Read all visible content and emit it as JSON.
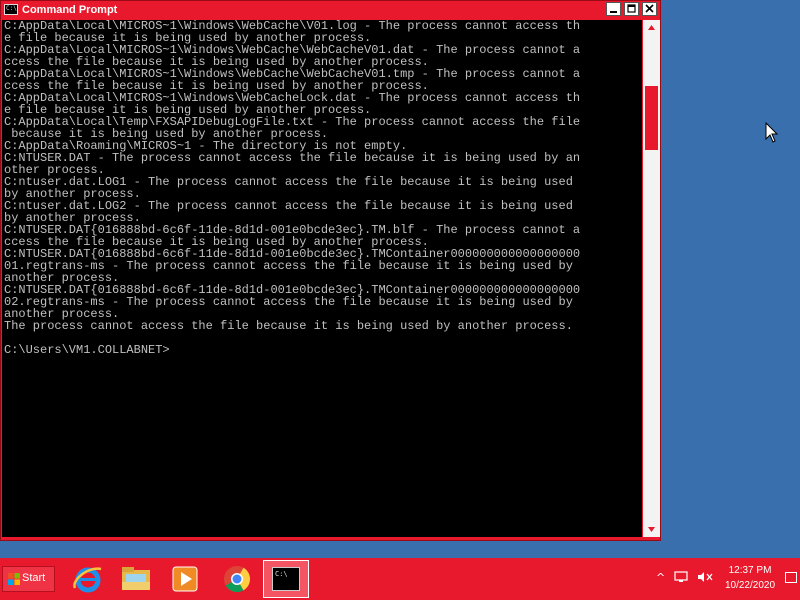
{
  "window": {
    "title": "Command Prompt",
    "icon_text": "C:\\",
    "minimize_icon": "minimize-icon",
    "maximize_icon": "maximize-icon",
    "close_icon": "close-icon"
  },
  "console": {
    "lines": [
      "C:AppData\\Local\\MICROS~1\\Windows\\WebCache\\V01.log - The process cannot access th",
      "e file because it is being used by another process.",
      "C:AppData\\Local\\MICROS~1\\Windows\\WebCache\\WebCacheV01.dat - The process cannot a",
      "ccess the file because it is being used by another process.",
      "C:AppData\\Local\\MICROS~1\\Windows\\WebCache\\WebCacheV01.tmp - The process cannot a",
      "ccess the file because it is being used by another process.",
      "C:AppData\\Local\\MICROS~1\\Windows\\WebCacheLock.dat - The process cannot access th",
      "e file because it is being used by another process.",
      "C:AppData\\Local\\Temp\\FXSAPIDebugLogFile.txt - The process cannot access the file",
      " because it is being used by another process.",
      "C:AppData\\Roaming\\MICROS~1 - The directory is not empty.",
      "C:NTUSER.DAT - The process cannot access the file because it is being used by an",
      "other process.",
      "C:ntuser.dat.LOG1 - The process cannot access the file because it is being used",
      "by another process.",
      "C:ntuser.dat.LOG2 - The process cannot access the file because it is being used",
      "by another process.",
      "C:NTUSER.DAT{016888bd-6c6f-11de-8d1d-001e0bcde3ec}.TM.blf - The process cannot a",
      "ccess the file because it is being used by another process.",
      "C:NTUSER.DAT{016888bd-6c6f-11de-8d1d-001e0bcde3ec}.TMContainer000000000000000000",
      "01.regtrans-ms - The process cannot access the file because it is being used by",
      "another process.",
      "C:NTUSER.DAT{016888bd-6c6f-11de-8d1d-001e0bcde3ec}.TMContainer000000000000000000",
      "02.regtrans-ms - The process cannot access the file because it is being used by",
      "another process.",
      "The process cannot access the file because it is being used by another process.",
      "",
      "C:\\Users\\VM1.COLLABNET>"
    ]
  },
  "taskbar": {
    "start_label": "Start",
    "cmd_task_text": "C:\\",
    "apps": [
      "internet-explorer-icon",
      "file-explorer-icon",
      "media-player-icon",
      "chrome-icon",
      "command-prompt-icon"
    ]
  },
  "tray": {
    "time": "12:37 PM",
    "date": "10/22/2020",
    "chevron": "^"
  },
  "colors": {
    "accent": "#e8192c",
    "desktop": "#3a6fae",
    "console_bg": "#000000",
    "console_fg": "#c0c0c0"
  }
}
